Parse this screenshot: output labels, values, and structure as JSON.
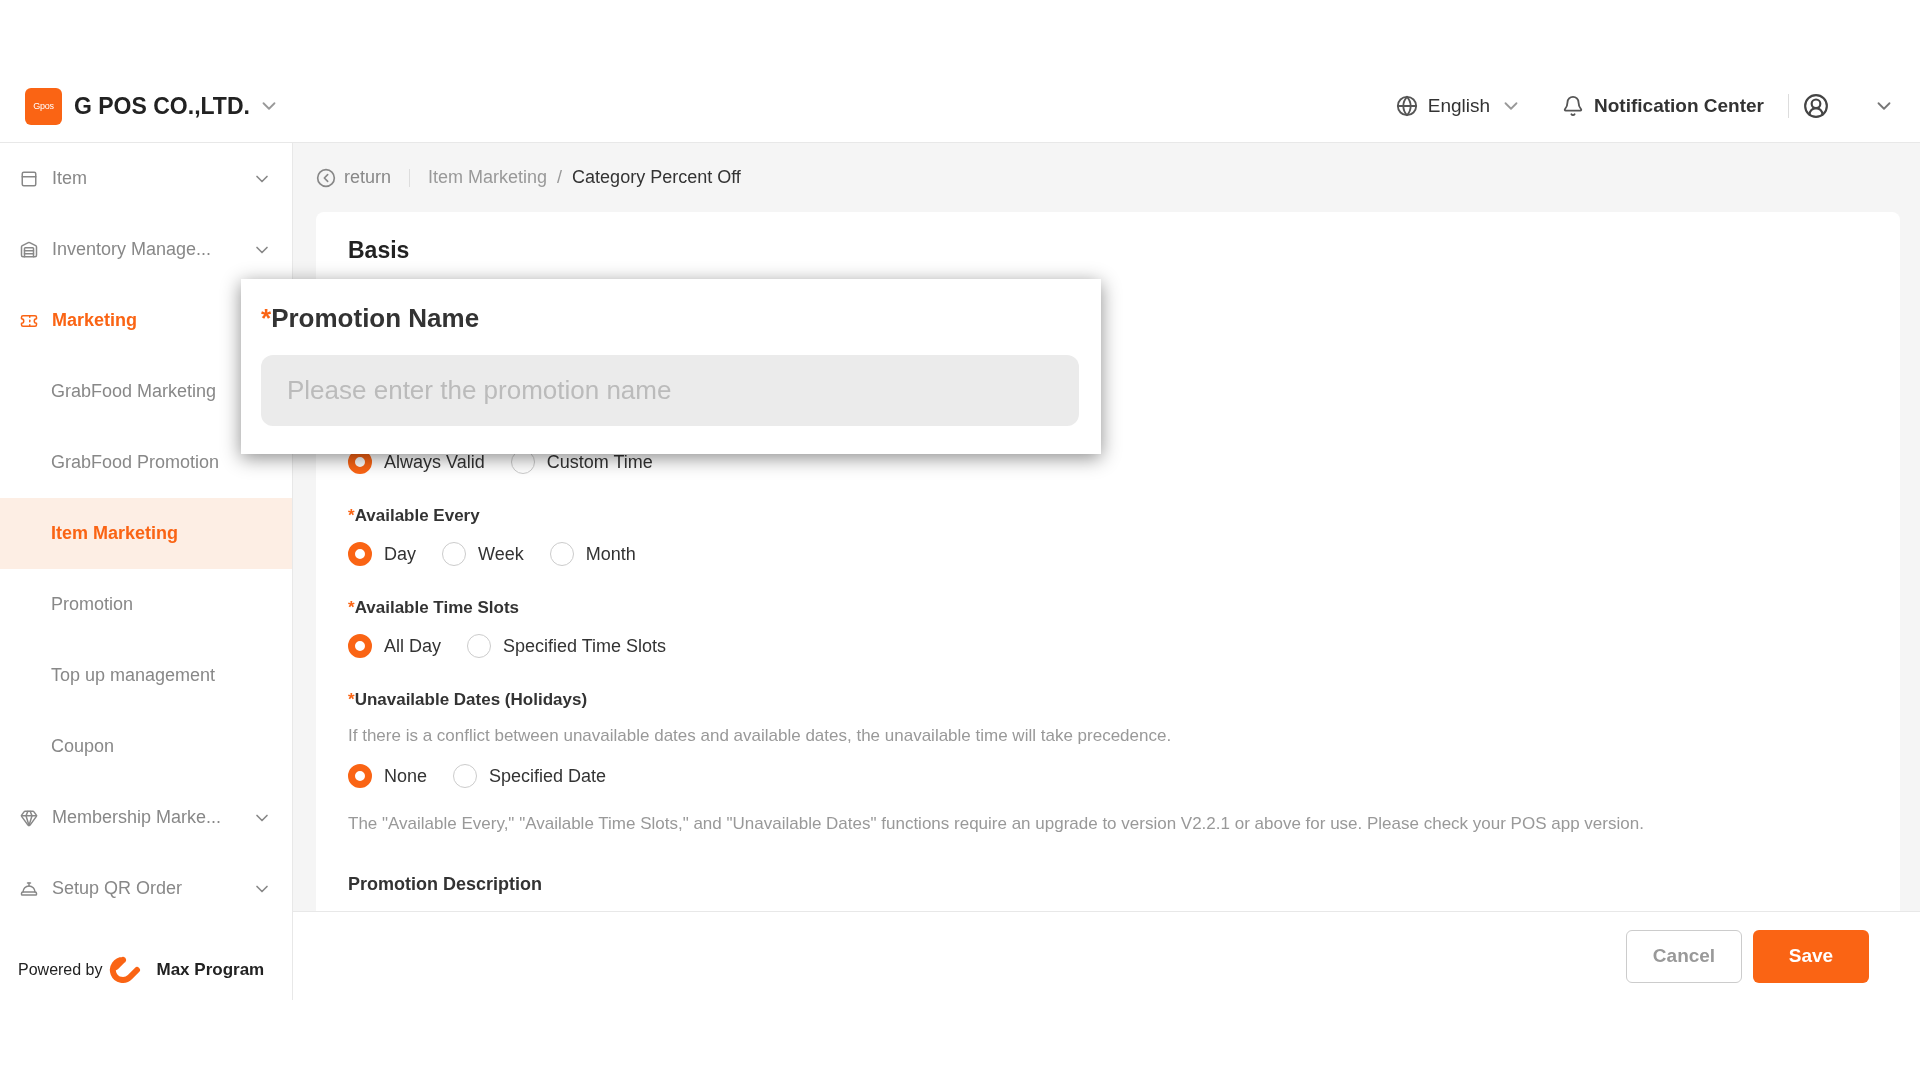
{
  "header": {
    "logo_text": "Gpos",
    "company": "G POS CO.,LTD.",
    "language": "English",
    "notifications": "Notification Center"
  },
  "sidebar": {
    "items": [
      {
        "label": "Item",
        "active": false,
        "expanded": false
      },
      {
        "label": "Inventory Manage...",
        "active": false,
        "expanded": false
      },
      {
        "label": "Marketing",
        "active": true,
        "expanded": true,
        "children": [
          {
            "label": "GrabFood Marketing",
            "selected": false
          },
          {
            "label": "GrabFood Promotion",
            "selected": false
          },
          {
            "label": "Item Marketing",
            "selected": true
          },
          {
            "label": "Promotion",
            "selected": false
          },
          {
            "label": "Top up management",
            "selected": false
          },
          {
            "label": "Coupon",
            "selected": false
          }
        ]
      },
      {
        "label": "Membership Marke...",
        "active": false,
        "expanded": false
      },
      {
        "label": "Setup QR Order",
        "active": false,
        "expanded": false
      }
    ],
    "powered_by": "Powered by",
    "brand": "Max Program"
  },
  "breadcrumb": {
    "back": "return",
    "separator": "/",
    "items": [
      "Item Marketing",
      "Category Percent Off"
    ]
  },
  "form": {
    "title": "Basis",
    "groups": [
      {
        "options": [
          {
            "label": "Always Valid",
            "selected": true
          },
          {
            "label": "Custom Time",
            "selected": false
          }
        ]
      },
      {
        "label": "Available Every",
        "required_mark": "*",
        "options": [
          {
            "label": "Day",
            "selected": true
          },
          {
            "label": "Week",
            "selected": false
          },
          {
            "label": "Month",
            "selected": false
          }
        ]
      },
      {
        "label": "Available Time Slots",
        "required_mark": "*",
        "options": [
          {
            "label": "All Day",
            "selected": true
          },
          {
            "label": "Specified Time Slots",
            "selected": false
          }
        ]
      },
      {
        "label": "Unavailable Dates (Holidays)",
        "required_mark": "*",
        "hint": "If there is a conflict between unavailable dates and available dates, the unavailable time will take precedence.",
        "options": [
          {
            "label": "None",
            "selected": true
          },
          {
            "label": "Specified Date",
            "selected": false
          }
        ]
      }
    ],
    "note": "The \"Available Every,\" \"Available Time Slots,\" and \"Unavailable Dates\" functions require an upgrade to version V2.2.1 or above for use. Please check your POS app version.",
    "section": "Promotion Description"
  },
  "popup": {
    "label": "Promotion Name",
    "required_mark": "*",
    "placeholder": "Please enter the promotion name"
  },
  "footer": {
    "buttons": [
      {
        "label": "Cancel",
        "kind": "secondary"
      },
      {
        "label": "Save",
        "kind": "primary"
      }
    ]
  }
}
